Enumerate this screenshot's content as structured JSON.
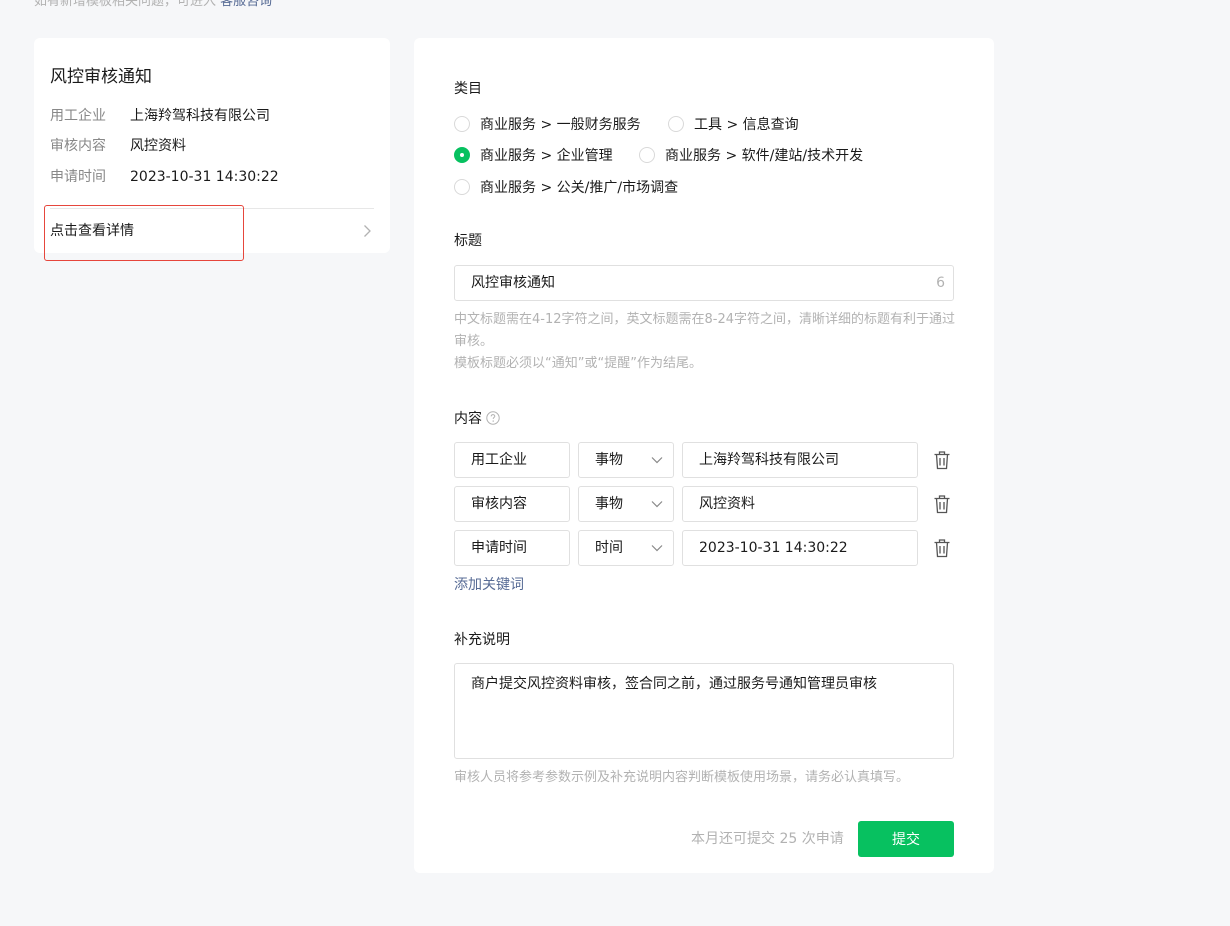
{
  "top_note": {
    "text": "如有新增模板相关问题，可进入",
    "link": "客服咨询"
  },
  "preview": {
    "title": "风控审核通知",
    "rows": [
      {
        "key": "用工企业",
        "value": "上海羚驾科技有限公司"
      },
      {
        "key": "审核内容",
        "value": "风控资料"
      },
      {
        "key": "申请时间",
        "value": "2023-10-31 14:30:22"
      }
    ],
    "detail_link": "点击查看详情"
  },
  "form": {
    "category": {
      "label": "类目",
      "options": [
        {
          "label": "商业服务 > 一般财务服务",
          "checked": false
        },
        {
          "label": "工具 > 信息查询",
          "checked": false
        },
        {
          "label": "商业服务 > 企业管理",
          "checked": true
        },
        {
          "label": "商业服务 > 软件/建站/技术开发",
          "checked": false
        },
        {
          "label": "商业服务 > 公关/推广/市场调查",
          "checked": false
        }
      ]
    },
    "title": {
      "label": "标题",
      "value": "风控审核通知",
      "count": "6",
      "hint_line1": "中文标题需在4-12字符之间，英文标题需在8-24字符之间，清晰详细的标题有利于通过审核。",
      "hint_line2": "模板标题必须以“通知”或“提醒”作为结尾。"
    },
    "content": {
      "label": "内容",
      "keywords": [
        {
          "name": "用工企业",
          "type": "事物",
          "value": "上海羚驾科技有限公司"
        },
        {
          "name": "审核内容",
          "type": "事物",
          "value": "风控资料"
        },
        {
          "name": "申请时间",
          "type": "时间",
          "value": "2023-10-31 14:30:22"
        }
      ],
      "add_label": "添加关键词"
    },
    "supplement": {
      "label": "补充说明",
      "value": "商户提交风控资料审核，签合同之前，通过服务号通知管理员审核",
      "hint": "审核人员将参考参数示例及补充说明内容判断模板使用场景，请务必认真填写。"
    },
    "quota_text": "本月还可提交 25 次申请",
    "submit_label": "提交"
  },
  "colors": {
    "accent": "#07c160",
    "link": "#576b95",
    "highlight": "#e6463c"
  }
}
